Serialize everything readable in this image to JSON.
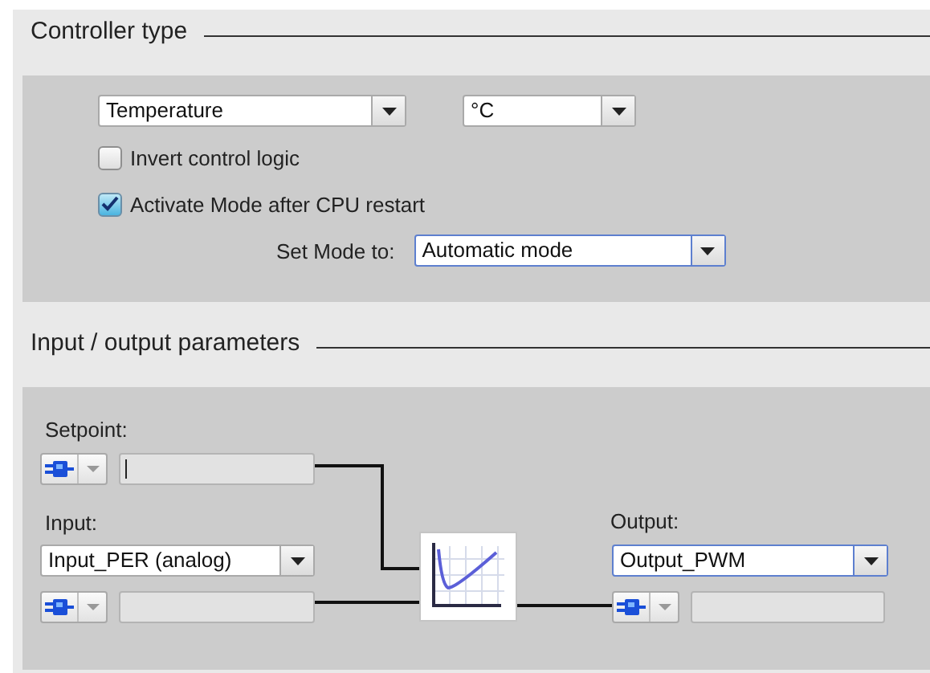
{
  "controller_type": {
    "title": "Controller type",
    "type_dropdown": {
      "value": "Temperature",
      "focused": false
    },
    "unit_dropdown": {
      "value": "°C",
      "focused": false
    },
    "checkboxes": [
      {
        "label": "Invert control logic",
        "checked": false
      },
      {
        "label": "Activate Mode after CPU restart",
        "checked": true
      }
    ],
    "set_mode": {
      "label": "Set Mode to:",
      "value": "Automatic mode",
      "focused": true
    }
  },
  "io_parameters": {
    "title": "Input / output parameters",
    "setpoint": {
      "label": "Setpoint:",
      "field_focused": true
    },
    "input": {
      "label": "Input:",
      "value": "Input_PER (analog)",
      "focused": false
    },
    "output": {
      "label": "Output:",
      "value": "Output_PWM",
      "focused": true
    }
  }
}
